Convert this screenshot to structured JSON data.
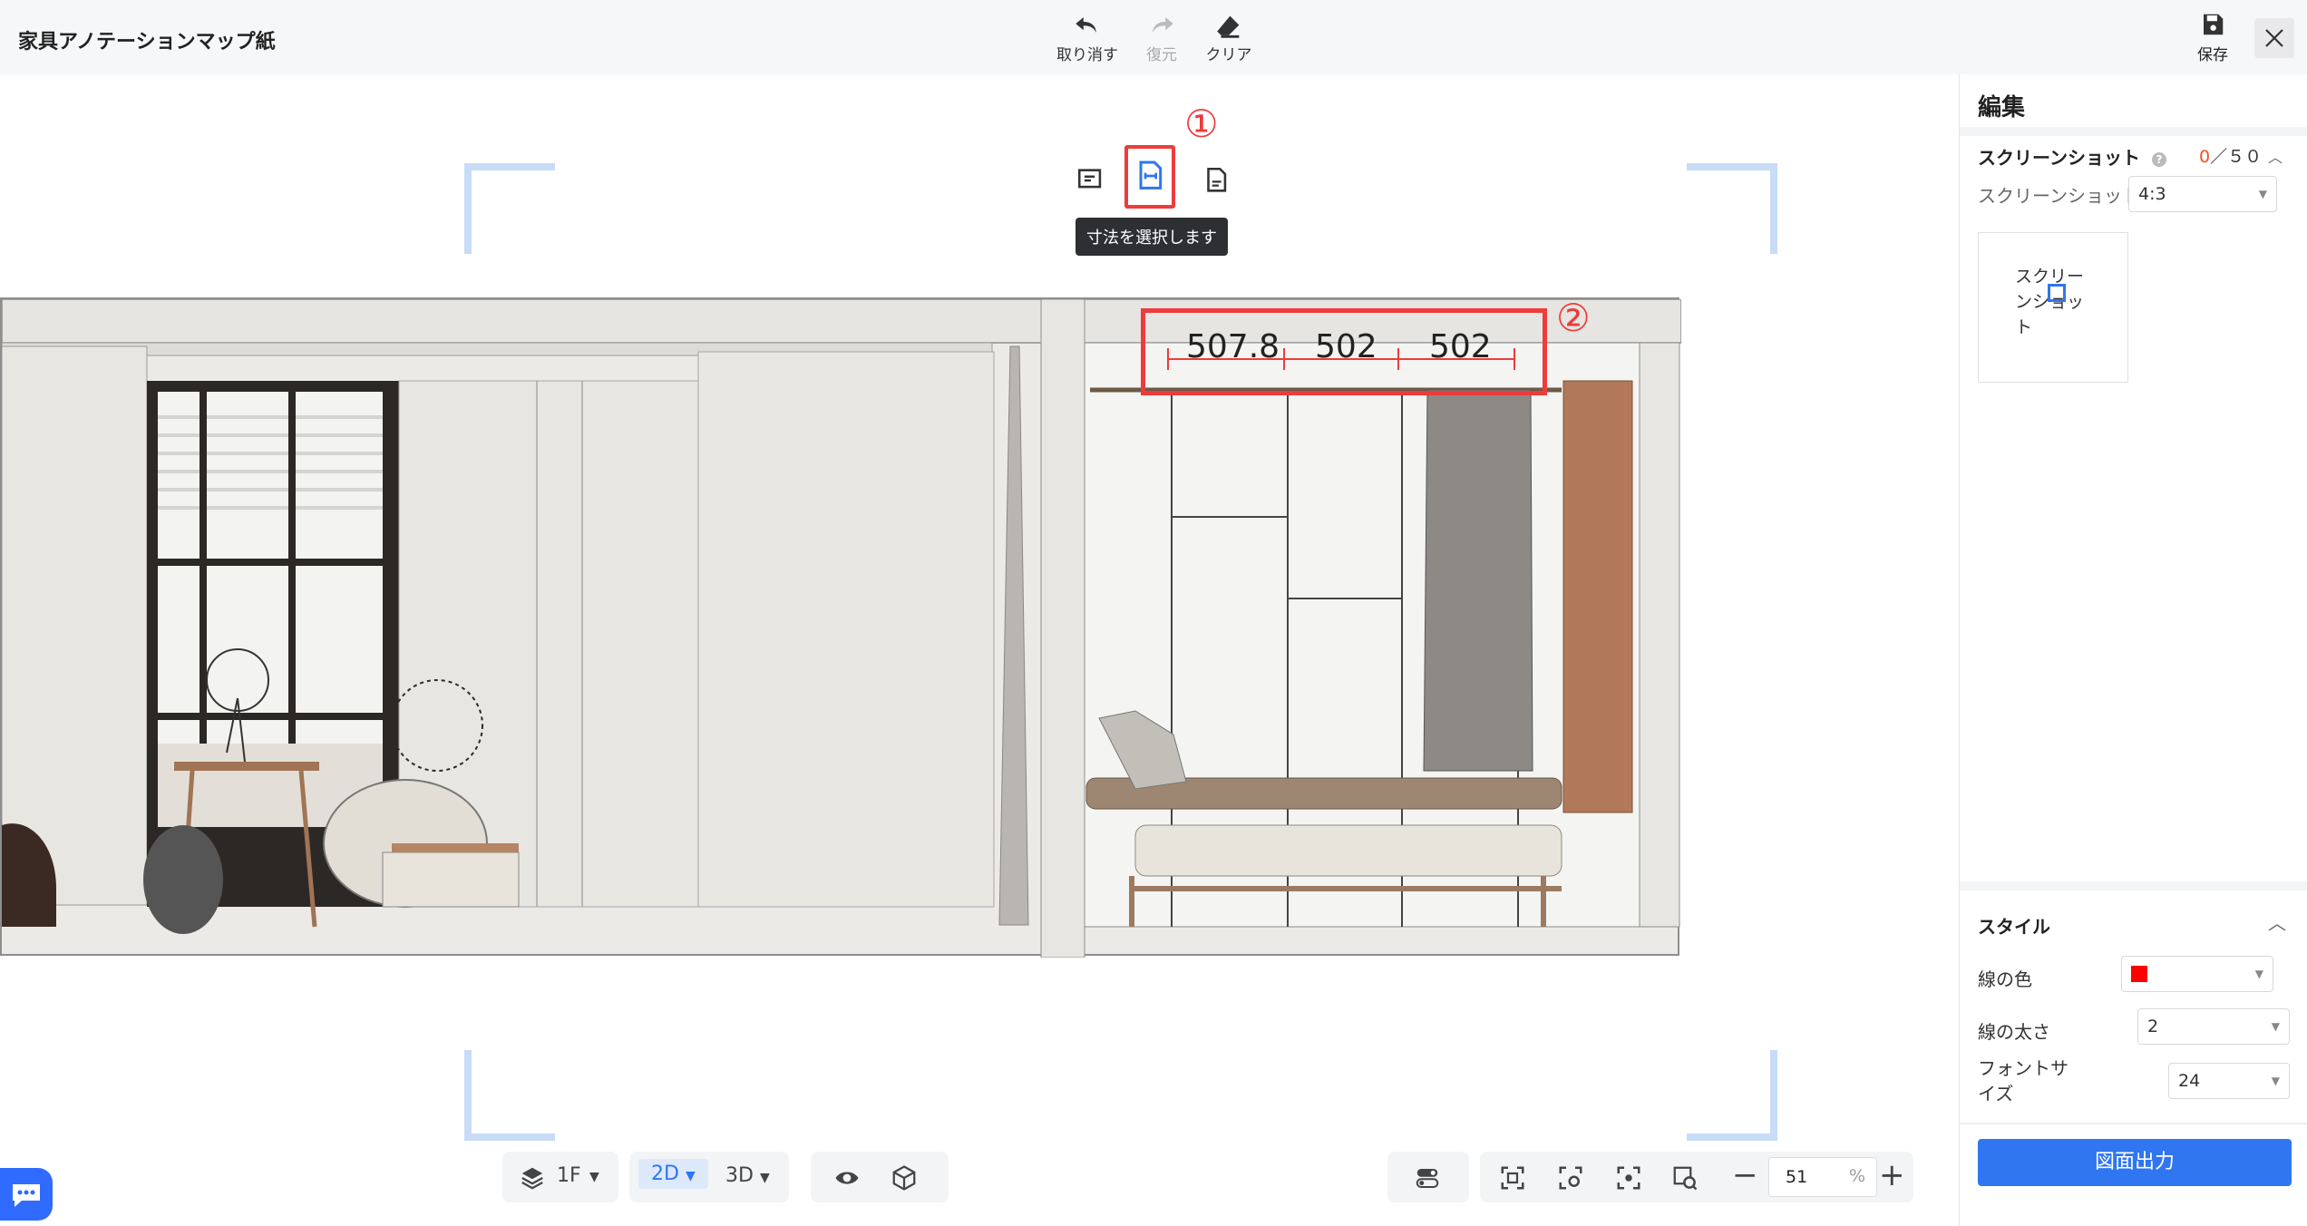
{
  "app": {
    "title": "家具アノテーションマップ紙"
  },
  "toolbar": {
    "undo_label": "取り消す",
    "redo_label": "復元",
    "clear_label": "クリア",
    "save_label": "保存"
  },
  "canvas": {
    "tooltip": "寸法を選択します",
    "step1": "①",
    "step2": "②",
    "dimensions": [
      "507.8",
      "502",
      "502"
    ],
    "dimension_color": "#ee3b3b"
  },
  "bottom": {
    "floor": "1F",
    "view2d": "2D",
    "view3d": "3D",
    "zoom_value": "51",
    "zoom_unit": "%"
  },
  "panel": {
    "title": "編集",
    "screenshot_section": "スクリーンショット",
    "screenshot_count": "0",
    "screenshot_limit": "／５０",
    "ratio_label": "スクリーンショットの比率",
    "ratio_value": "4:3",
    "add_screenshot": "スクリーンショット",
    "style_section": "スタイル",
    "line_color_label": "線の色",
    "line_color": "#ff0000",
    "line_width_label": "線の太さ",
    "line_width_value": "2",
    "font_size_label": "フォントサイズ",
    "font_size_value": "24",
    "output_button": "図面出力"
  }
}
